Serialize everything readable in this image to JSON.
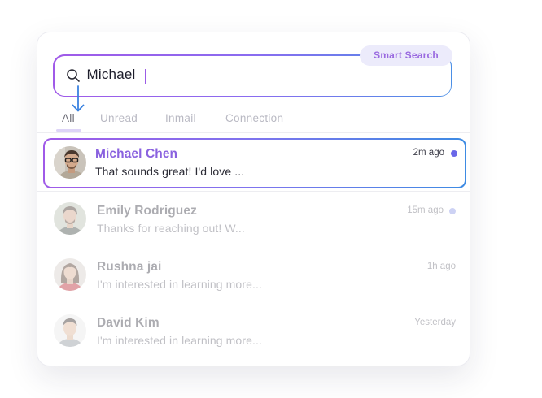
{
  "search": {
    "value": "Michael",
    "smart_search_label": "Smart Search"
  },
  "tabs": [
    {
      "label": "All",
      "active": true
    },
    {
      "label": "Unread",
      "active": false
    },
    {
      "label": "Inmail",
      "active": false
    },
    {
      "label": "Connection",
      "active": false
    }
  ],
  "conversations": [
    {
      "name": "Michael Chen",
      "preview": "That sounds great! I'd love ...",
      "time": "2m ago",
      "unread": true,
      "selected": true
    },
    {
      "name": "Emily Rodriguez",
      "preview": "Thanks for reaching out! W...",
      "time": "15m ago",
      "unread": true,
      "selected": false
    },
    {
      "name": "Rushna jai",
      "preview": "I'm interested in learning more...",
      "time": "1h ago",
      "unread": false,
      "selected": false
    },
    {
      "name": "David Kim",
      "preview": "I'm interested in learning more...",
      "time": "Yesterday",
      "unread": false,
      "selected": false
    }
  ],
  "colors": {
    "accent_purple": "#a05ae8",
    "accent_blue": "#3d8be3",
    "unread_dot": "#6a67e8",
    "badge_bg": "#ecebfb"
  }
}
